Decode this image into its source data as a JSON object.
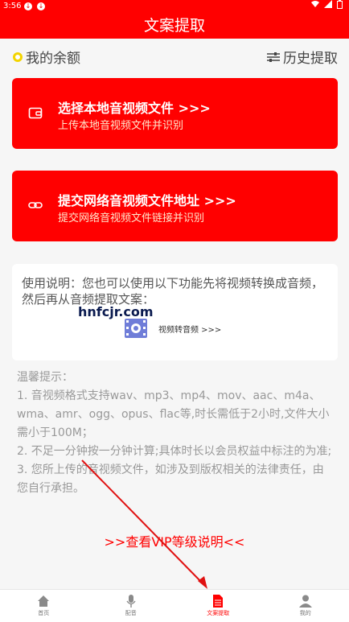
{
  "status_bar": {
    "time": "3:56",
    "download_glyph": "↓"
  },
  "header": {
    "title": "文案提取"
  },
  "balance": {
    "label": "我的余额"
  },
  "history": {
    "label": "历史提取"
  },
  "cards": [
    {
      "title": "选择本地音视频文件 >>>",
      "subtitle": "上传本地音视频文件并识别",
      "icon": "wallet-icon"
    },
    {
      "title": "提交网络音视频文件地址 >>>",
      "subtitle": "提交网络音视频文件链接并识别",
      "icon": "link-icon"
    }
  ],
  "help": {
    "text": "使用说明：您也可以使用以下功能先将视频转换成音频，然后再从音频提取文案：",
    "convert_label": "视频转音频 >>>"
  },
  "watermark": "hnfcjr.com",
  "tips": [
    "温馨提示：",
    "1. 音视频格式支持wav、mp3、mp4、mov、aac、m4a、wma、amr、ogg、opus、flac等,时长需低于2小时,文件大小需小于100M；",
    "2. 不足一分钟按一分钟计算;具体时长以会员权益中标注的为准;",
    "3. 您所上传的音视频文件，如涉及到版权相关的法律责任，由您自行承担。"
  ],
  "vip_link": ">>查看VIP等级说明<<",
  "tabs": [
    {
      "label": "首页",
      "icon": "home-icon"
    },
    {
      "label": "配音",
      "icon": "microphone-icon"
    },
    {
      "label": "文案提取",
      "icon": "document-icon",
      "active": true
    },
    {
      "label": "我的",
      "icon": "user-icon"
    }
  ],
  "colors": {
    "accent": "#ff0000",
    "coin": "#f3d400"
  }
}
